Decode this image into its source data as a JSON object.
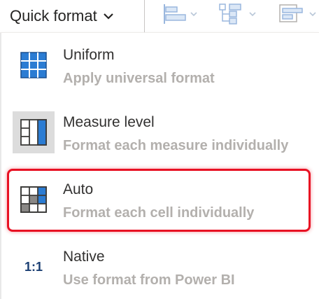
{
  "toolbar": {
    "quick_format_label": "Quick format",
    "icons": [
      "align-left-icon",
      "hierarchy-icon",
      "layout-icon"
    ]
  },
  "menu": {
    "items": [
      {
        "title": "Uniform",
        "description": "Apply universal format",
        "icon": "uniform-grid-icon"
      },
      {
        "title": "Measure level",
        "description": "Format each measure individually",
        "icon": "measure-columns-icon"
      },
      {
        "title": "Auto",
        "description": "Format each cell individually",
        "icon": "auto-grid-icon"
      },
      {
        "title": "Native",
        "description": "Use format from Power BI",
        "icon_text": "1:1"
      }
    ],
    "highlighted_item": "Auto"
  },
  "colors": {
    "accent_blue": "#2b7cd3",
    "highlight_red": "#e81123",
    "description_gray": "#b3b0ad",
    "title_dark": "#323130"
  }
}
